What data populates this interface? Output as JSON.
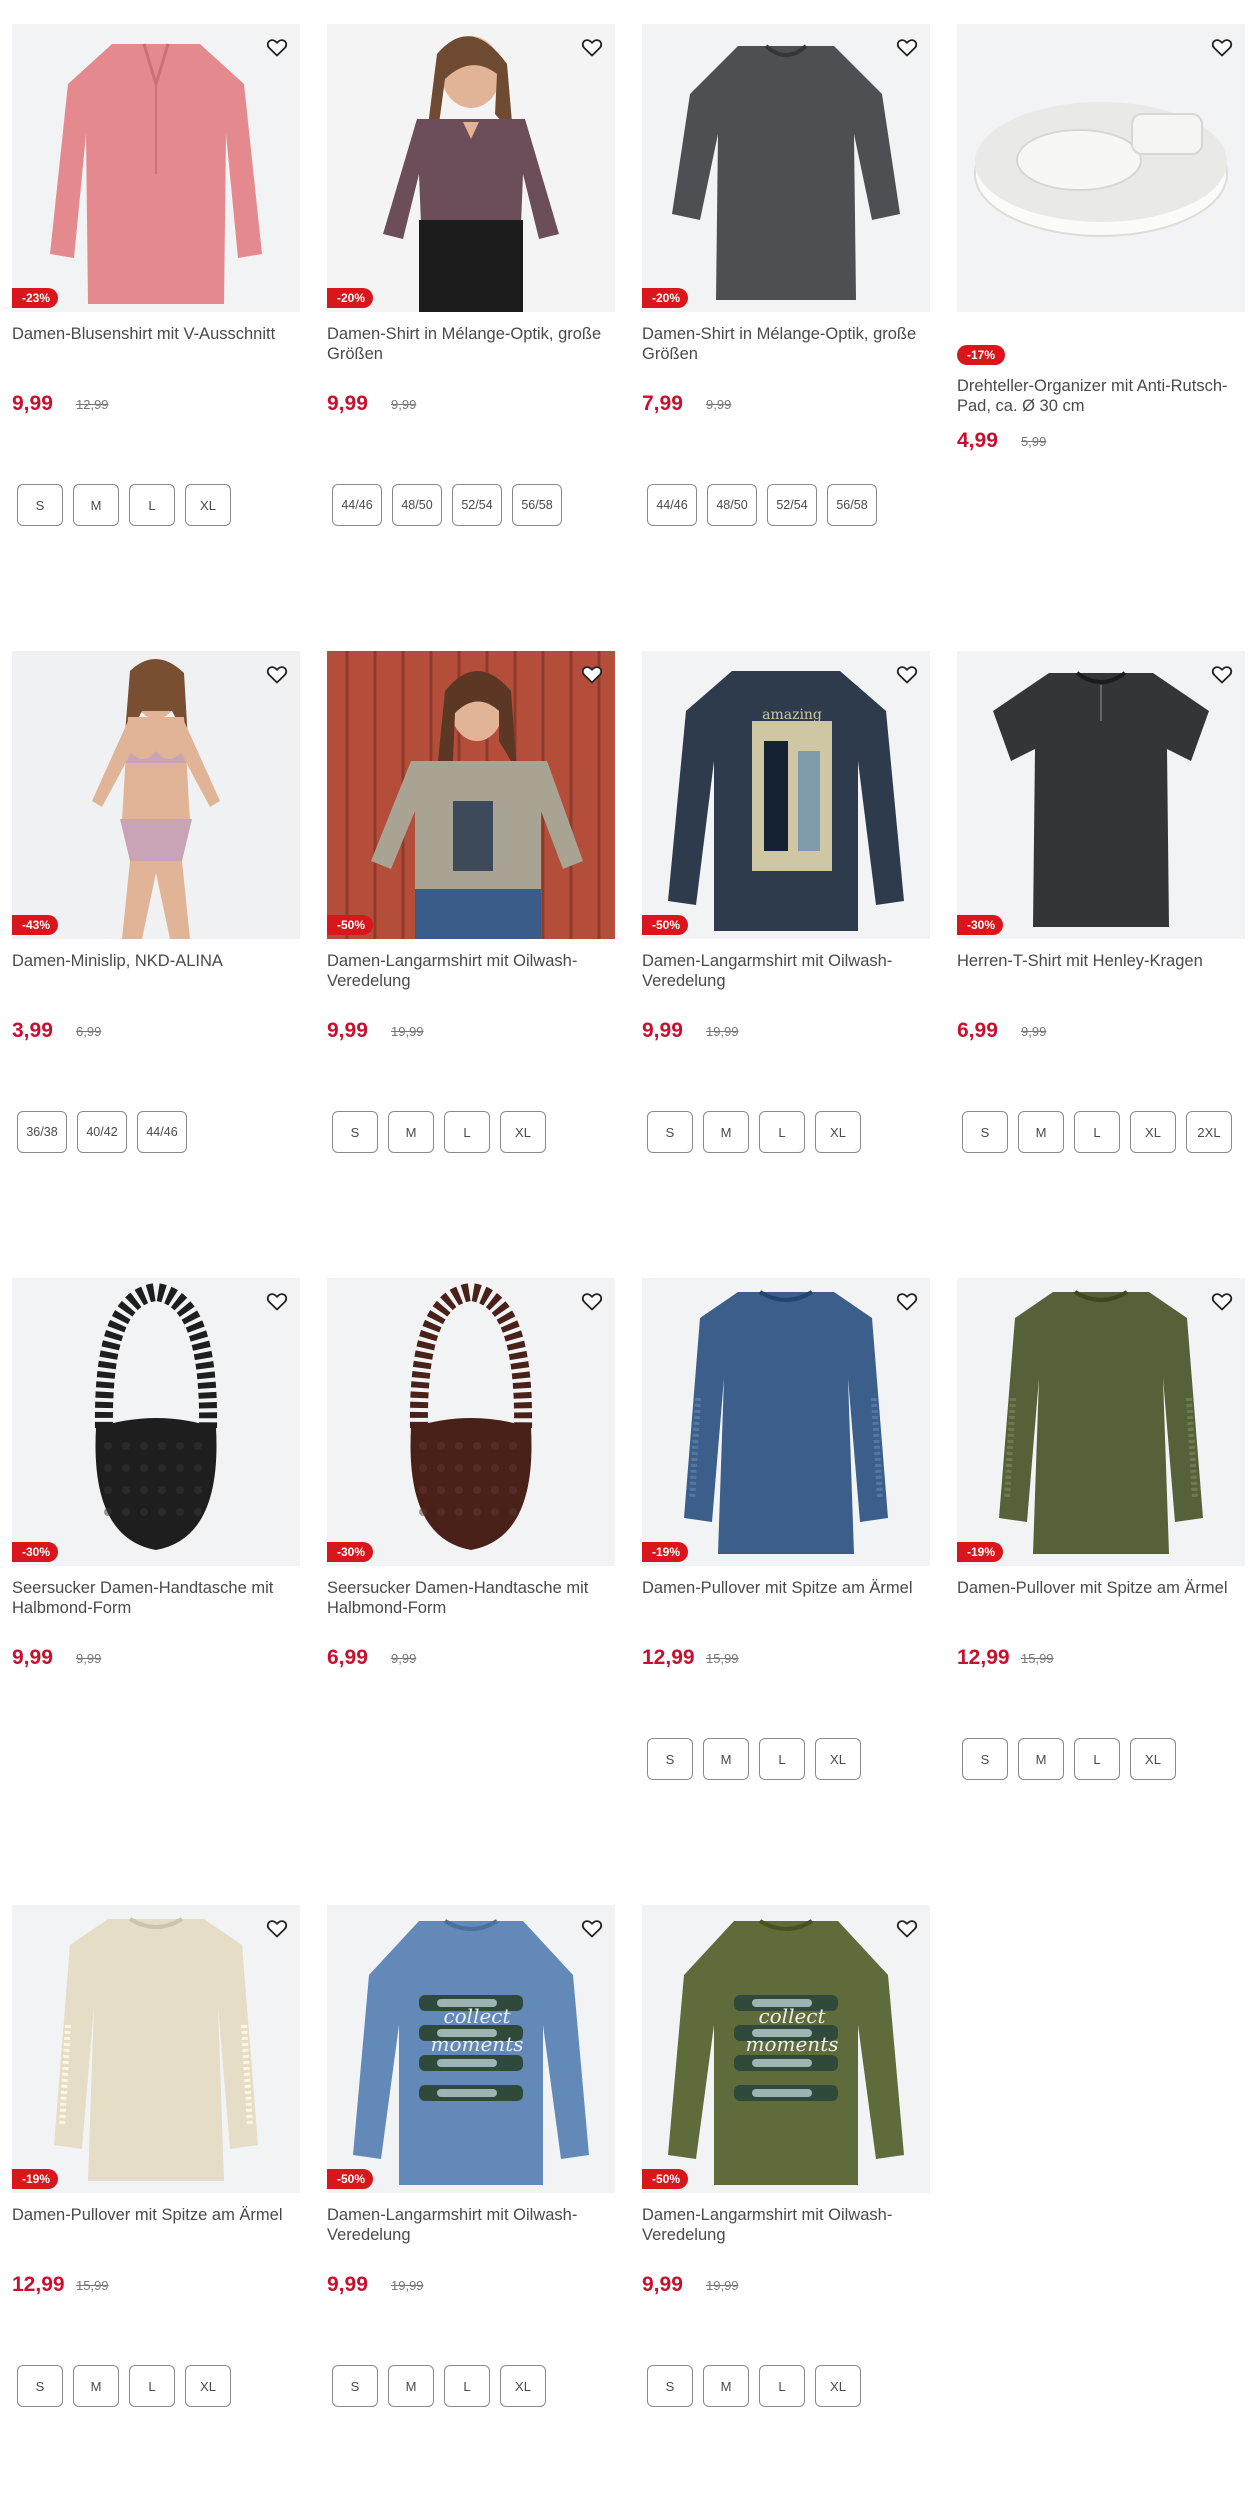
{
  "products": [
    {
      "badge": "-23%",
      "title": "Damen-Blusenshirt mit V-Ausschnitt",
      "price": "9,99",
      "old": "12,99",
      "sizes": [
        "S",
        "M",
        "L",
        "XL"
      ],
      "img": "blouse",
      "color": "#e48a8e"
    },
    {
      "badge": "-20%",
      "title": "Damen-Shirt in Mélange-Optik, große Größen",
      "price": "9,99",
      "old": "9,99",
      "sizes": [
        "44/46",
        "48/50",
        "52/54",
        "56/58"
      ],
      "img": "model-top",
      "color": "#6b4e59"
    },
    {
      "badge": "-20%",
      "title": "Damen-Shirt in Mélange-Optik, große Größen",
      "price": "7,99",
      "old": "9,99",
      "sizes": [
        "44/46",
        "48/50",
        "52/54",
        "56/58"
      ],
      "img": "shirt34",
      "color": "#4d4f52"
    },
    {
      "badge": "-17%",
      "title": "Drehteller-Organizer mit Anti-Rutsch-Pad, ca. Ø 30 cm",
      "price": "4,99",
      "old": "5,99",
      "sizes": [],
      "img": "organizer",
      "color": "#e9e9e7"
    },
    {
      "badge": "-43%",
      "title": "Damen-Minislip, NKD-ALINA",
      "price": "3,99",
      "old": "6,99",
      "sizes": [
        "36/38",
        "40/42",
        "44/46"
      ],
      "img": "model-lingerie",
      "color": "#c9a3b6"
    },
    {
      "badge": "-50%",
      "title": "Damen-Langarmshirt mit Oilwash-Veredelung",
      "price": "9,99",
      "old": "19,99",
      "sizes": [
        "S",
        "M",
        "L",
        "XL"
      ],
      "img": "model-wood",
      "color": "#a9a393"
    },
    {
      "badge": "-50%",
      "title": "Damen-Langarmshirt mit Oilwash-Veredelung",
      "price": "9,99",
      "old": "19,99",
      "sizes": [
        "S",
        "M",
        "L",
        "XL"
      ],
      "img": "longsleeve-print",
      "color": "#2d3b4c"
    },
    {
      "badge": "-30%",
      "title": "Herren-T-Shirt mit Henley-Kragen",
      "price": "6,99",
      "old": "9,99",
      "sizes": [
        "S",
        "M",
        "L",
        "XL",
        "2XL"
      ],
      "img": "tshirt",
      "color": "#343536"
    },
    {
      "badge": "-30%",
      "title": "Seersucker Damen-Handtasche mit Halbmond-Form",
      "price": "9,99",
      "old": "9,99",
      "sizes": [],
      "img": "bag",
      "color": "#1e1e1e"
    },
    {
      "badge": "-30%",
      "title": "Seersucker Damen-Handtasche mit Halbmond-Form",
      "price": "6,99",
      "old": "9,99",
      "sizes": [],
      "img": "bag",
      "color": "#4a2118"
    },
    {
      "badge": "-19%",
      "title": "Damen-Pullover mit Spitze am Ärmel",
      "price": "12,99",
      "old": "15,99",
      "sizes": [
        "S",
        "M",
        "L",
        "XL"
      ],
      "img": "pullover",
      "color": "#3c5e8a"
    },
    {
      "badge": "-19%",
      "title": "Damen-Pullover mit Spitze am Ärmel",
      "price": "12,99",
      "old": "15,99",
      "sizes": [
        "S",
        "M",
        "L",
        "XL"
      ],
      "img": "pullover",
      "color": "#56613a"
    },
    {
      "badge": "-19%",
      "title": "Damen-Pullover mit Spitze am Ärmel",
      "price": "12,99",
      "old": "15,99",
      "sizes": [
        "S",
        "M",
        "L",
        "XL"
      ],
      "img": "pullover",
      "color": "#e6ddc7"
    },
    {
      "badge": "-50%",
      "title": "Damen-Langarmshirt mit Oilwash-Veredelung",
      "price": "9,99",
      "old": "19,99",
      "sizes": [
        "S",
        "M",
        "L",
        "XL"
      ],
      "img": "raglan",
      "color": "#6289b8"
    },
    {
      "badge": "-50%",
      "title": "Damen-Langarmshirt mit Oilwash-Veredelung",
      "price": "9,99",
      "old": "19,99",
      "sizes": [
        "S",
        "M",
        "L",
        "XL"
      ],
      "img": "raglan",
      "color": "#5f6b3a"
    }
  ],
  "colors": {
    "accent": "#c8102e",
    "badge_bg": "#d8161b",
    "image_bg": "#f2f3f4"
  },
  "icons": {
    "wishlist": "heart-outline-icon"
  }
}
